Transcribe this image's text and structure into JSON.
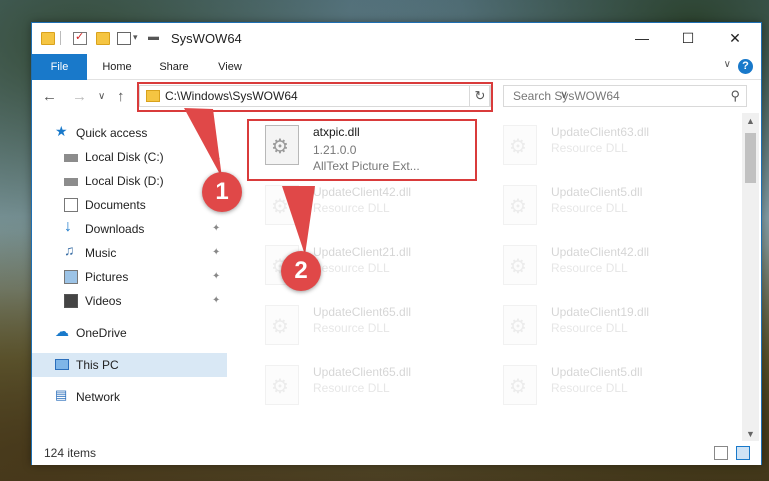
{
  "window": {
    "title": "SysWOW64"
  },
  "ribbon": {
    "tabs": [
      {
        "label": "File"
      },
      {
        "label": "Home"
      },
      {
        "label": "Share"
      },
      {
        "label": "View"
      }
    ],
    "help": "?"
  },
  "nav": {
    "address": "C:\\Windows\\SysWOW64",
    "search_placeholder": "Search SysWOW64"
  },
  "sidebar": {
    "items": [
      {
        "label": "Quick access"
      },
      {
        "label": "Local Disk (C:)"
      },
      {
        "label": "Local Disk (D:)"
      },
      {
        "label": "Documents"
      },
      {
        "label": "Downloads"
      },
      {
        "label": "Music"
      },
      {
        "label": "Pictures"
      },
      {
        "label": "Videos"
      },
      {
        "label": "OneDrive"
      },
      {
        "label": "This PC"
      },
      {
        "label": "Network"
      }
    ]
  },
  "files": [
    {
      "name": "atxpic.dll",
      "version": "1.21.0.0",
      "desc": "AllText Picture Ext..."
    },
    {
      "name": "UpdateClient63.dll",
      "desc": "Resource DLL"
    },
    {
      "name": "UpdateClient42.dll",
      "desc": "Resource DLL"
    },
    {
      "name": "UpdateClient5.dll",
      "desc": "Resource DLL"
    },
    {
      "name": "UpdateClient21.dll",
      "desc": "Resource DLL"
    },
    {
      "name": "UpdateClient42.dll",
      "desc": "Resource DLL"
    },
    {
      "name": "UpdateClient65.dll",
      "desc": "Resource DLL"
    },
    {
      "name": "UpdateClient19.dll",
      "desc": "Resource DLL"
    },
    {
      "name": "UpdateClient65.dll",
      "desc": "Resource DLL"
    },
    {
      "name": "UpdateClient5.dll",
      "desc": "Resource DLL"
    }
  ],
  "status": {
    "item_count": "124 items"
  },
  "callouts": {
    "one": "1",
    "two": "2"
  },
  "colors": {
    "accent": "#1979ca",
    "callout": "#e04848",
    "highlight_box": "#d93b3b"
  }
}
